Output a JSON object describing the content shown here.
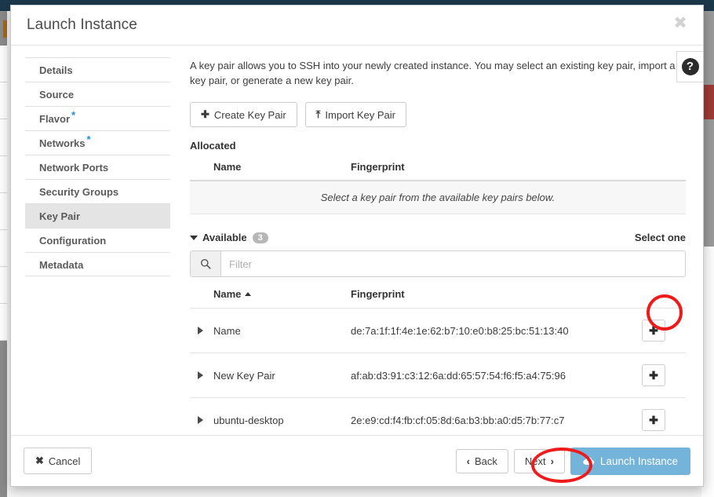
{
  "modal": {
    "title": "Launch Instance",
    "close_label": "✖"
  },
  "wizard_nav": [
    {
      "label": "Details",
      "required": "",
      "active": false
    },
    {
      "label": "Source",
      "required": "",
      "active": false
    },
    {
      "label": "Flavor",
      "required": "*",
      "active": false
    },
    {
      "label": "Networks",
      "required": "*",
      "active": false
    },
    {
      "label": "Network Ports",
      "required": "",
      "active": false
    },
    {
      "label": "Security Groups",
      "required": "",
      "active": false
    },
    {
      "label": "Key Pair",
      "required": "",
      "active": true
    },
    {
      "label": "Configuration",
      "required": "",
      "active": false
    },
    {
      "label": "Metadata",
      "required": "",
      "active": false
    }
  ],
  "main": {
    "intro": "A key pair allows you to SSH into your newly created instance. You may select an existing key pair, import a key pair, or generate a new key pair.",
    "help_glyph": "?",
    "create_key_pair_label": "Create Key Pair",
    "create_key_pair_glyph": "✚",
    "import_key_pair_label": "Import Key Pair",
    "import_key_pair_glyph": "⤒",
    "allocated_label": "Allocated",
    "allocated_columns": {
      "name": "Name",
      "fingerprint": "Fingerprint"
    },
    "allocated_empty_message": "Select a key pair from the available key pairs below.",
    "available_label": "Available",
    "available_count": "3",
    "select_one_label": "Select one",
    "filter_placeholder": "Filter",
    "filter_value": "",
    "available_columns": {
      "name": "Name",
      "fingerprint": "Fingerprint"
    },
    "add_glyph": "✚",
    "rows": [
      {
        "name": "Name",
        "fingerprint": "de:7a:1f:1f:4e:1e:62:b7:10:e0:b8:25:bc:51:13:40"
      },
      {
        "name": "New Key Pair",
        "fingerprint": "af:ab:d3:91:c3:12:6a:dd:65:57:54:f6:f5:a4:75:96"
      },
      {
        "name": "ubuntu-desktop",
        "fingerprint": "2e:e9:cd:f4:fb:cf:05:8d:6a:b3:bb:a0:d5:7b:77:c7"
      }
    ]
  },
  "footer": {
    "cancel_label": "Cancel",
    "cancel_glyph": "✖",
    "back_label": "Back",
    "back_glyph": "‹",
    "next_label": "Next",
    "next_glyph": "›",
    "launch_label": "Launch Instance"
  },
  "colors": {
    "accent_blue": "#74b4db",
    "required_star": "#1f8fd6",
    "annotation_red": "#ee1b1b",
    "badge_gray": "#b7b7b7",
    "bg_topbar_navy": "#1b384b"
  }
}
